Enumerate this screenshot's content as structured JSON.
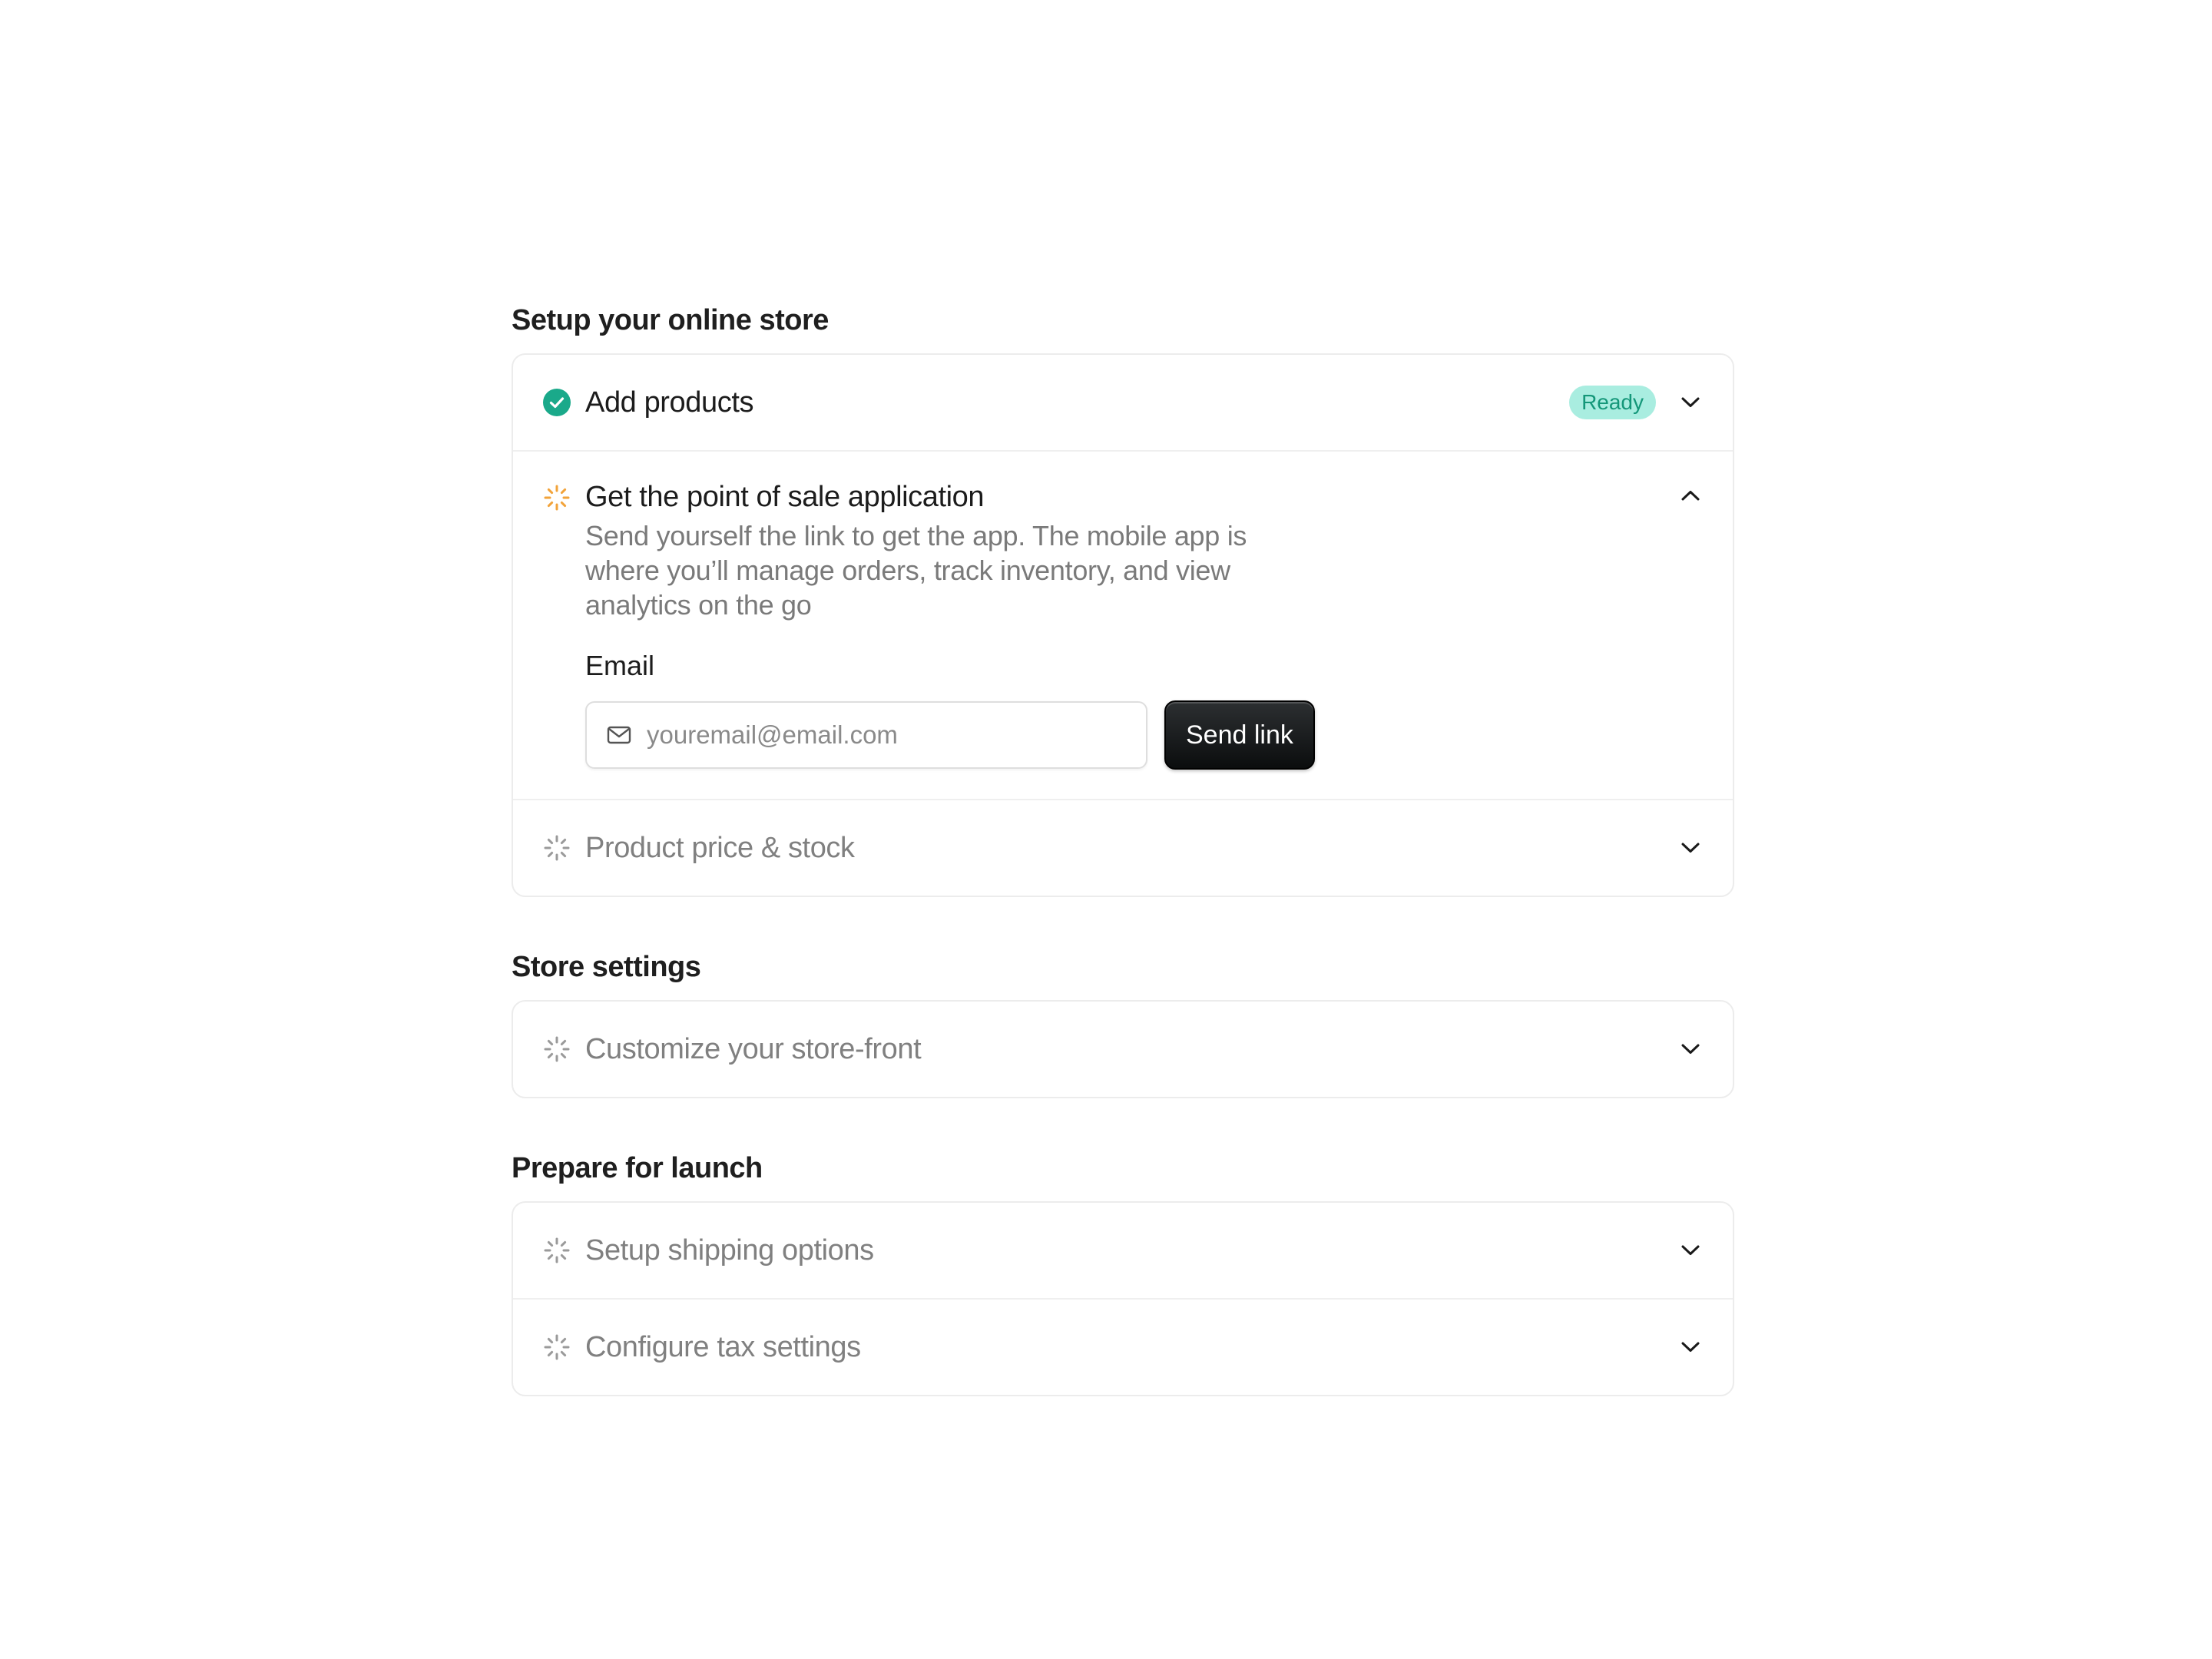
{
  "sections": [
    {
      "title": "Setup your online store",
      "items": [
        {
          "title": "Add products",
          "badge": "Ready",
          "status": "complete"
        },
        {
          "title": "Get the point of sale application",
          "status": "in-progress",
          "description": "Send yourself the link to get the app. The mobile app is where you’ll manage orders, track inventory, and view analytics on the go",
          "email_label": "Email",
          "email_placeholder": "youremail@email.com",
          "send_label": "Send link"
        },
        {
          "title": "Product price & stock",
          "status": "pending"
        }
      ]
    },
    {
      "title": "Store settings",
      "items": [
        {
          "title": "Customize your store-front",
          "status": "pending"
        }
      ]
    },
    {
      "title": "Prepare for launch",
      "items": [
        {
          "title": "Setup shipping options",
          "status": "pending"
        },
        {
          "title": "Configure tax settings",
          "status": "pending"
        }
      ]
    }
  ],
  "icons": {
    "complete": "check-circle-icon",
    "in_progress": "spinner-icon",
    "pending": "spinner-icon",
    "expand": "chevron-down-icon",
    "collapse": "chevron-up-icon",
    "mail": "mail-icon"
  },
  "colors": {
    "accent_green": "#1aa98a",
    "badge_bg": "#a9ede0",
    "badge_text": "#149779",
    "in_progress_orange": "#f2a33a",
    "pending_gray": "#9a9a9a",
    "button_dark": "#111314"
  }
}
